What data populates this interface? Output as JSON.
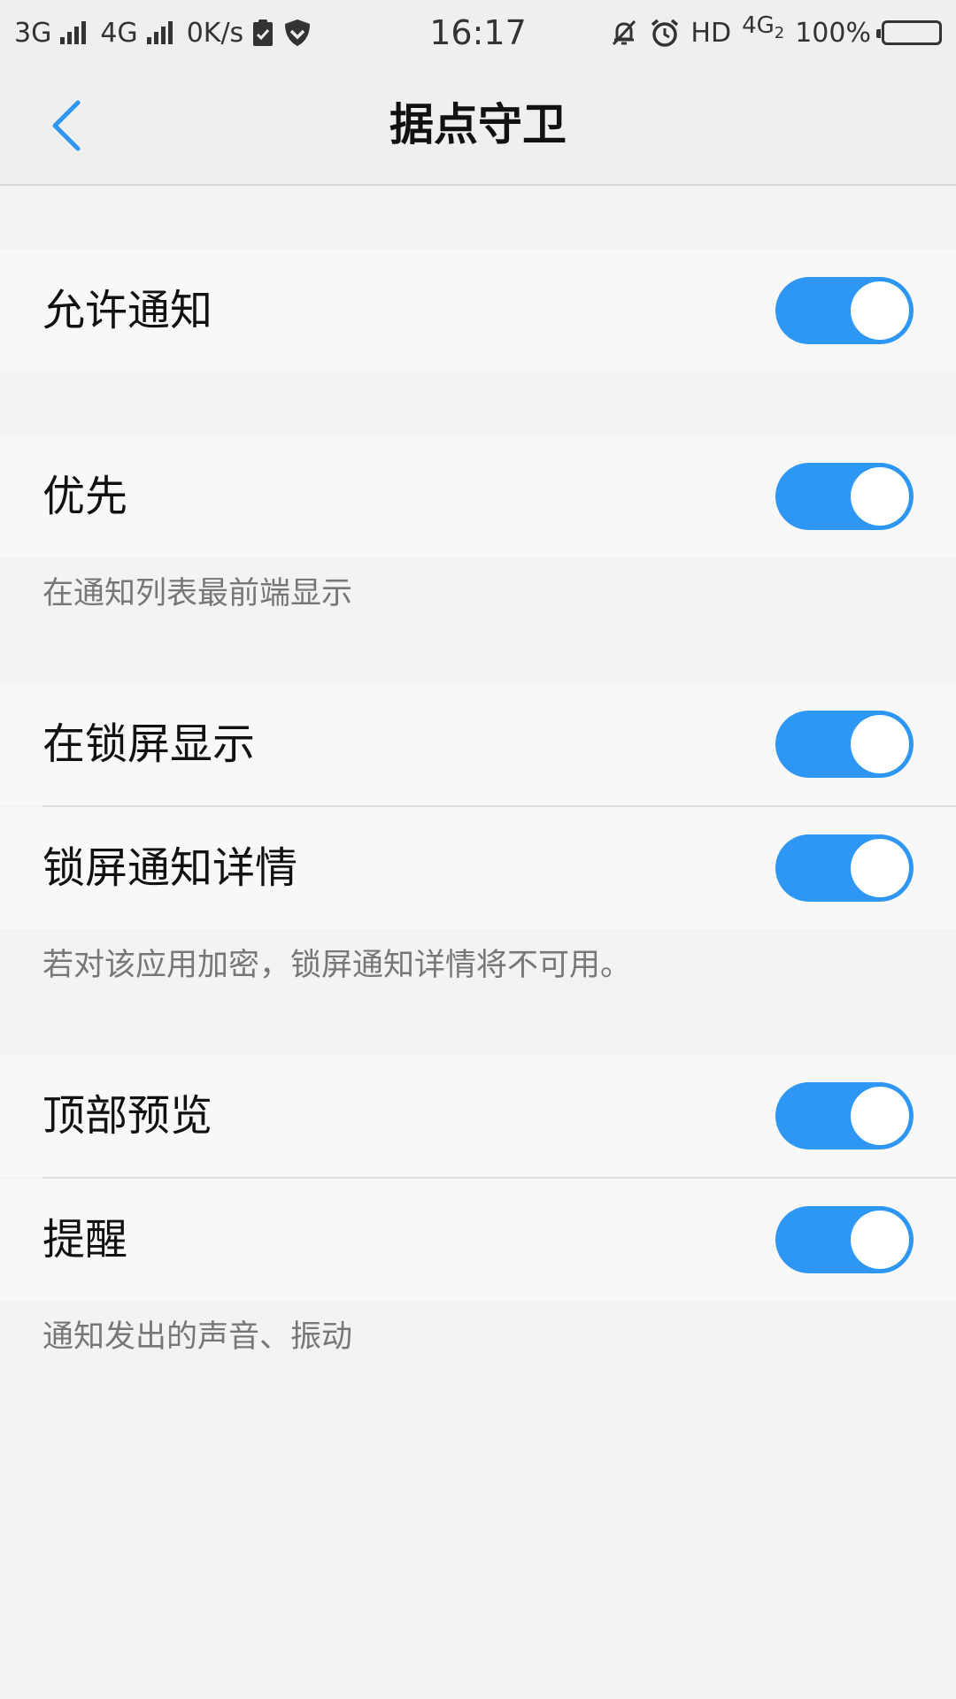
{
  "status_bar": {
    "net1": "3G",
    "net2": "4G",
    "speed": "0K/s",
    "time": "16:17",
    "hd": "HD",
    "net3": "4G",
    "net3_sub": "2",
    "battery": "100%"
  },
  "header": {
    "title": "据点守卫"
  },
  "settings": {
    "allow_notify": {
      "label": "允许通知",
      "on": true
    },
    "priority": {
      "label": "优先",
      "on": true
    },
    "priority_hint": "在通知列表最前端显示",
    "lockscreen_show": {
      "label": "在锁屏显示",
      "on": true
    },
    "lockscreen_detail": {
      "label": "锁屏通知详情",
      "on": true
    },
    "lockscreen_hint": "若对该应用加密，锁屏通知详情将不可用。",
    "top_preview": {
      "label": "顶部预览",
      "on": true
    },
    "remind": {
      "label": "提醒",
      "on": true
    },
    "remind_hint": "通知发出的声音、振动"
  },
  "colors": {
    "accent": "#2e96f5",
    "background": "#f3f3f3",
    "row_background": "#f8f8f8"
  }
}
